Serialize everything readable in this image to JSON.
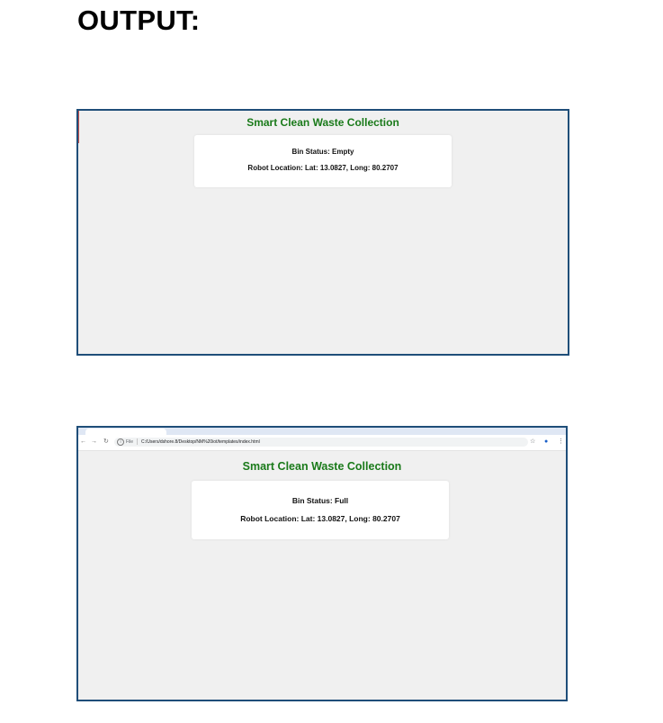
{
  "heading": "OUTPUT:",
  "screenshots": [
    {
      "app_title": "Smart Clean Waste Collection",
      "bin_status": "Bin Status: Empty",
      "robot_location": "Robot Location: Lat: 13.0827, Long: 80.2707"
    },
    {
      "browser": {
        "file_label": "File",
        "url": "C:/Users/dshore.8/Desktop/NM%20iot/templates/index.html",
        "icons": {
          "back": "back-arrow-icon",
          "forward": "forward-arrow-icon",
          "reload": "reload-icon",
          "info": "info-icon",
          "star": "star-icon",
          "profile": "profile-icon",
          "menu": "kebab-menu-icon"
        }
      },
      "app_title": "Smart Clean Waste Collection",
      "bin_status": "Bin Status: Full",
      "robot_location": "Robot Location: Lat: 13.0827, Long: 80.2707"
    }
  ],
  "colors": {
    "title_green": "#1a7a1a",
    "frame_border": "#1f4e79",
    "page_background": "#f0f0f0",
    "card_background": "#ffffff"
  }
}
